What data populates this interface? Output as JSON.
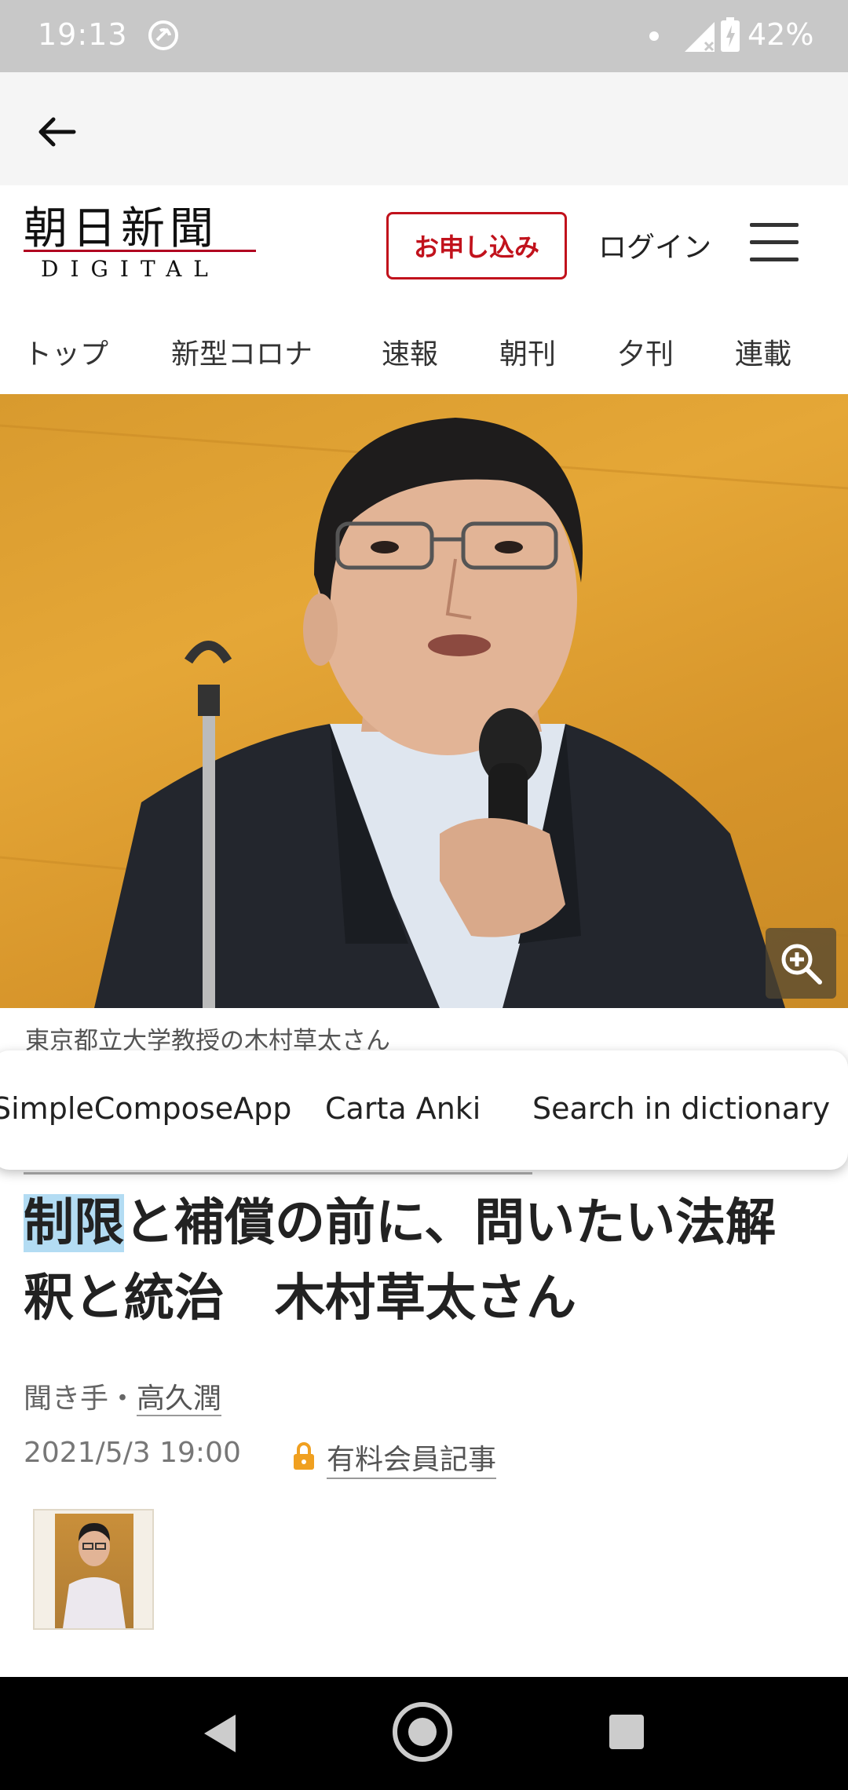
{
  "status_bar": {
    "time": "19:13",
    "battery": "42%"
  },
  "header": {
    "logo_kanji": "朝日新聞",
    "logo_sub": "DIGITAL",
    "subscribe_label": "お申し込み",
    "login_label": "ログイン"
  },
  "nav_tabs": [
    "トップ",
    "新型コロナ",
    "速報",
    "朝刊",
    "夕刊",
    "連載"
  ],
  "hero": {
    "caption": "東京都立大学教授の木村草太さん"
  },
  "selection_menu": {
    "items": [
      "SimpleComposeApp",
      "Carta Anki",
      "Search in dictionary"
    ]
  },
  "article": {
    "headline_selected": "制限",
    "headline_rest": "と補償の前に、問いたい法解釈と統治　木村草太さん",
    "byline_prefix": "聞き手・",
    "author": "高久潤",
    "date": "2021/5/3 19:00",
    "paid_label": "有料会員記事"
  },
  "colors": {
    "brand_red": "#c1121c",
    "selection_blue": "#b3dcf3",
    "hero_orange": "#e5a737"
  }
}
